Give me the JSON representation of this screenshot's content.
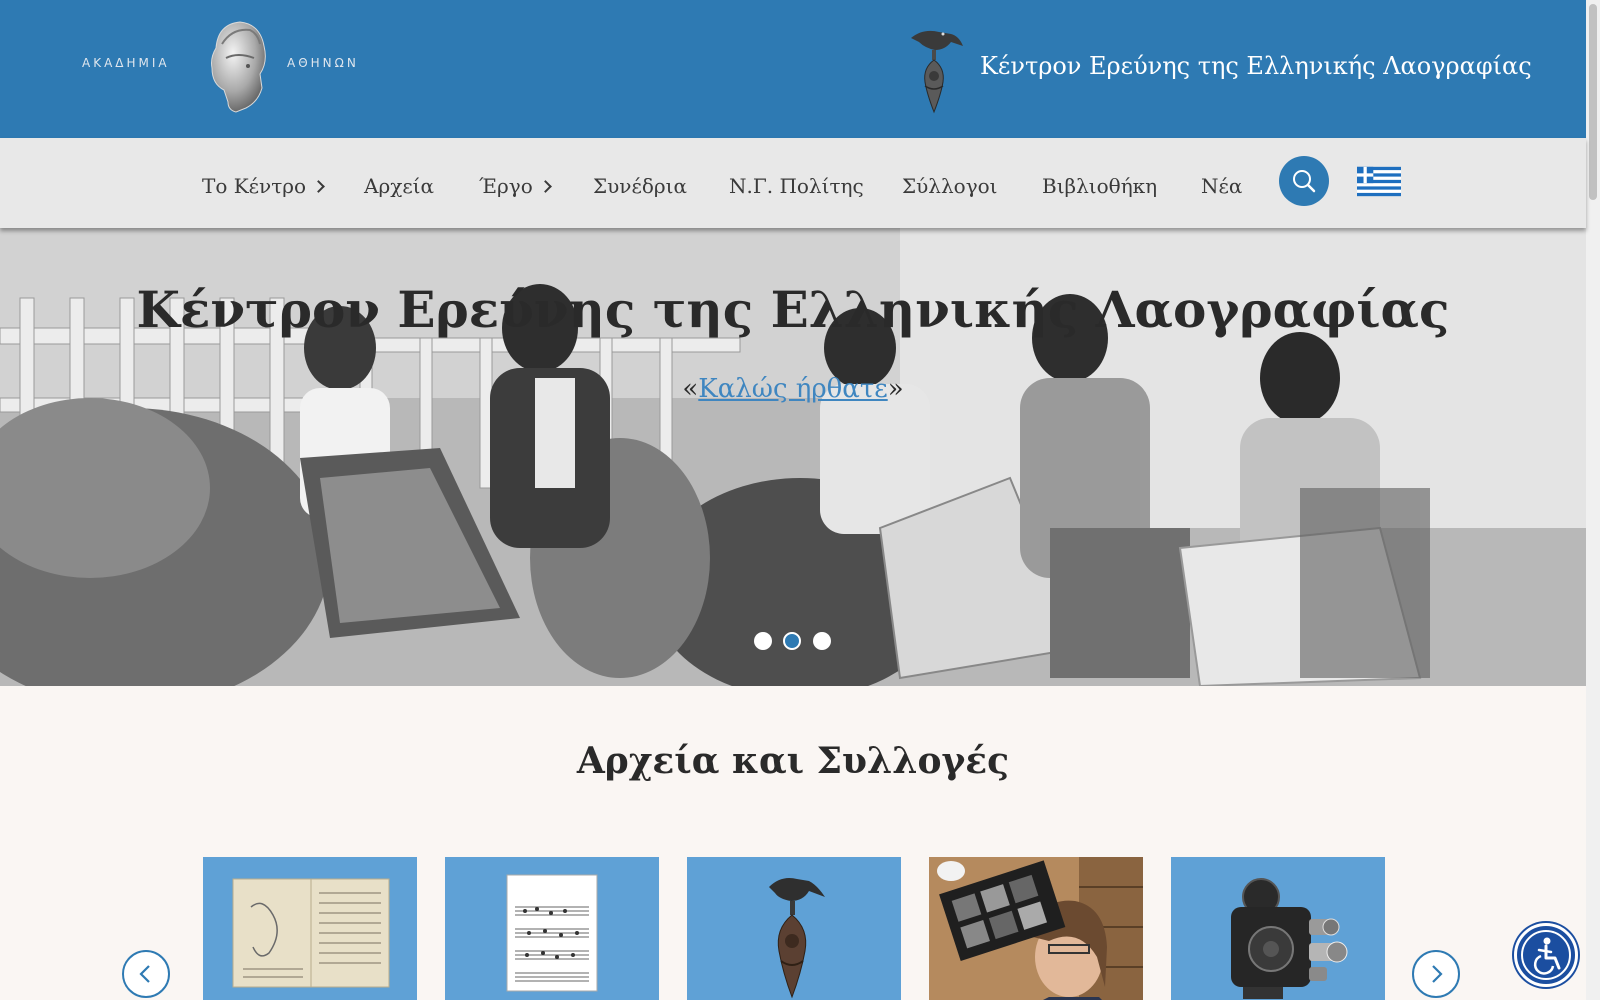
{
  "header": {
    "academy_left": "ΑΚΑΔΗΜΙΑ",
    "academy_right": "ΑΘΗΝΩΝ",
    "center_title": "Κέντρον Ερεύνης της Ελληνικής Λαογραφίας"
  },
  "nav": {
    "items": [
      {
        "label": "Το Κέντρο",
        "has_submenu": true
      },
      {
        "label": "Αρχεία",
        "has_submenu": false
      },
      {
        "label": "Έργο",
        "has_submenu": true
      },
      {
        "label": "Συνέδρια",
        "has_submenu": false
      },
      {
        "label": "Ν.Γ. Πολίτης",
        "has_submenu": false
      },
      {
        "label": "Σύλλογοι",
        "has_submenu": false
      },
      {
        "label": "Βιβλιοθήκη",
        "has_submenu": false
      },
      {
        "label": "Νέα",
        "has_submenu": false
      }
    ],
    "search_icon": "search-icon",
    "language_icon": "greek-flag-icon"
  },
  "hero": {
    "title": "Κέντρον Ερεύνης της Ελληνικής Λαογραφίας",
    "quote_open": "«",
    "link_text": "Καλώς ήρθατε",
    "quote_close": "»",
    "slides_total": 3,
    "active_slide": 2
  },
  "collections": {
    "title": "Αρχεία και Συλλογές",
    "cards": [
      {
        "icon": "manuscript-icon"
      },
      {
        "icon": "sheet-music-icon"
      },
      {
        "icon": "bird-emblem-icon"
      },
      {
        "icon": "film-archive-photo-icon"
      },
      {
        "icon": "film-camera-icon"
      }
    ],
    "prev_icon": "chevron-left-icon",
    "next_icon": "chevron-right-icon"
  },
  "accessibility": {
    "icon": "accessibility-icon"
  },
  "colors": {
    "header_blue": "#2e7ab3",
    "nav_gray": "#e8e8e8",
    "card_blue": "#5fa1d6",
    "link_blue": "#3f86c0",
    "page_bg": "#faf6f3"
  }
}
